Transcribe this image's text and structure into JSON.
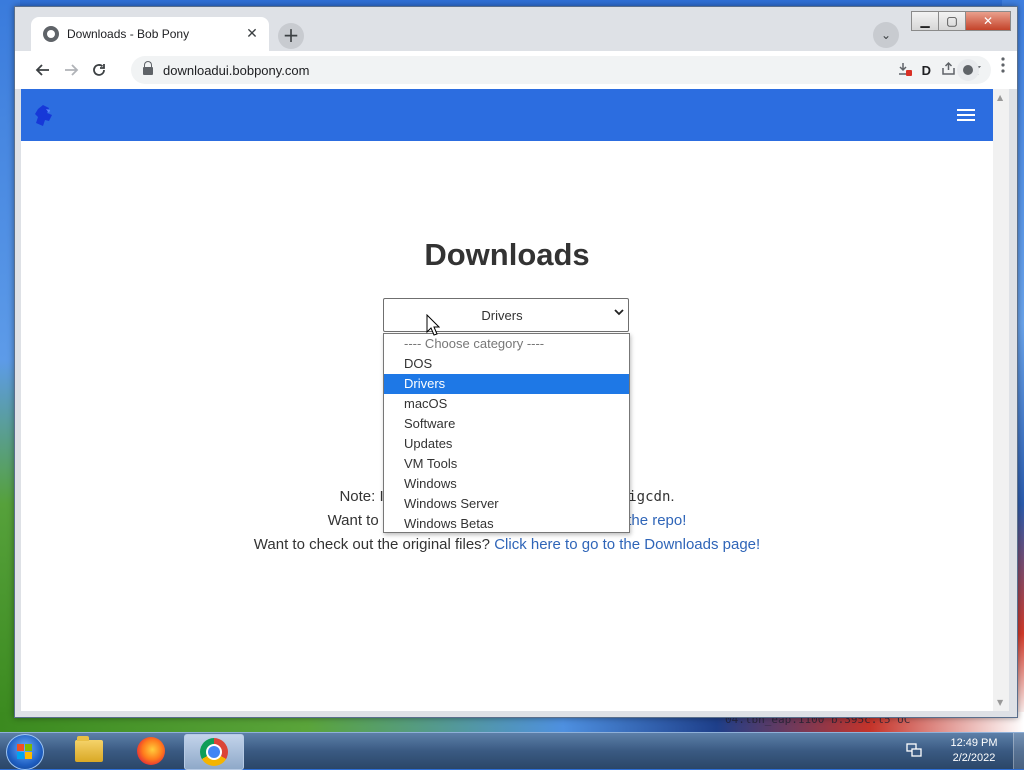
{
  "browser": {
    "tab_title": "Downloads - Bob Pony",
    "tab_close": "✕",
    "new_tab": "+",
    "tab_search": "⌄",
    "url": "downloadui.bobpony.com",
    "omnibox_letter": "D"
  },
  "window": {
    "minimize": "▁",
    "maximize": "▢",
    "close": "✕"
  },
  "page": {
    "heading": "Downloads",
    "select_value": "Drivers",
    "select_arrow": "⌄",
    "dropdown_options": [
      "---- Choose category ----",
      "DOS",
      "Drivers",
      "macOS",
      "Software",
      "Updates",
      "VM Tools",
      "Windows",
      "Windows Server",
      "Windows Betas"
    ],
    "selected_option": "Drivers",
    "note_line1_start": "Note: If",
    "note_line1_end_code": "bigcdn",
    "note_line1_end": ".",
    "note_line2_start": "Want to h",
    "note_line2_link": "the repo!",
    "note_line3_text": "Want to check out the original files?",
    "note_line3_link": "Click here to go to the Downloads page!"
  },
  "desktop": {
    "background_text": "04.lbn_eap.1100         b.395c.l5    UC"
  },
  "taskbar": {
    "time": "12:49 PM",
    "date": "2/2/2022"
  },
  "colors": {
    "navbar": "#2c6de0",
    "selected_option": "#1e78e6",
    "link": "#2f65b8"
  },
  "icons": {
    "back": "arrow-left-icon",
    "forward": "arrow-right-icon",
    "reload": "reload-icon",
    "lock": "lock-icon",
    "download_blocked": "download-blocked-icon",
    "share": "share-icon",
    "star": "bookmark-star-icon",
    "profile": "profile-icon",
    "menu": "kebab-menu-icon",
    "hamburger": "hamburger-menu-icon",
    "logo": "bobpony-logo-icon",
    "cursor": "mouse-pointer-icon"
  }
}
